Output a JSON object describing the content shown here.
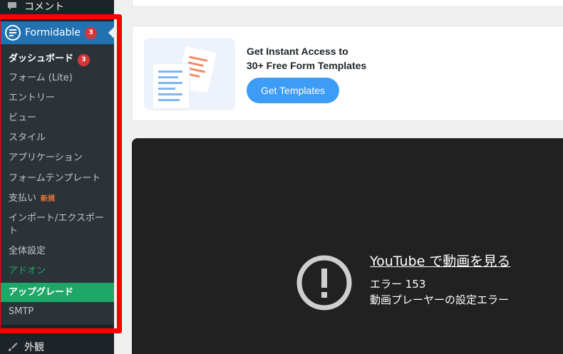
{
  "sidebar": {
    "comment_label": "コメント",
    "formidable_label": "Formidable",
    "formidable_badge": "3",
    "appearance_label": "外観",
    "submenu": {
      "dashboard": "ダッシュボード",
      "dashboard_badge": "3",
      "forms": "フォーム (Lite)",
      "entries": "エントリー",
      "views": "ビュー",
      "styles": "スタイル",
      "applications": "アプリケーション",
      "form_templates": "フォームテンプレート",
      "payments": "支払い",
      "payments_new": "新規",
      "import_export": "インポート/エクスポート",
      "global_settings": "全体設定",
      "addons": "アドオン",
      "upgrade": "アップグレード",
      "smtp": "SMTP"
    }
  },
  "promo": {
    "title_line1": "Get Instant Access to",
    "title_line2": "30+ Free Form Templates",
    "button_label": "Get Templates"
  },
  "video": {
    "link_text": "YouTube で動画を見る",
    "error_code": "エラー 153",
    "error_message": "動画プレーヤーの設定エラー"
  },
  "colors": {
    "admin_bg": "#1d2327",
    "submenu_bg": "#2c3338",
    "active_blue": "#2271b1",
    "badge_red": "#d63638",
    "upgrade_green": "#1da867",
    "button_blue": "#3d9cf5",
    "highlight_red": "#ff0000"
  }
}
